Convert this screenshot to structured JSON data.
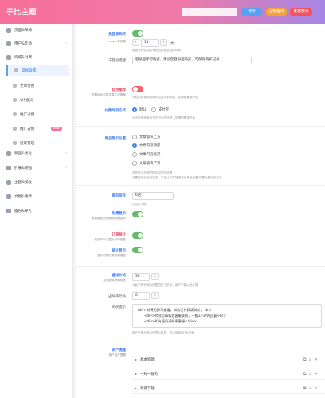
{
  "header": {
    "logo": "子比主题",
    "save_label": "保存",
    "export_label": "全部备份",
    "reset_label": "重置部分"
  },
  "sidebar": {
    "items": [
      {
        "label": "页面&布局",
        "icon": "layout-icon"
      },
      {
        "label": "用户&互动",
        "icon": "user-icon"
      },
      {
        "label": "商城&付费",
        "icon": "shop-icon"
      }
    ],
    "subitems": [
      {
        "label": "常规设置",
        "active": true
      },
      {
        "label": "文章付费"
      },
      {
        "label": "VIP会员"
      },
      {
        "label": "推广返佣"
      },
      {
        "label": "推广返佣",
        "badge": "NEW"
      },
      {
        "label": "提现管理"
      }
    ],
    "lower_items": [
      {
        "label": "新品&优化",
        "icon": "star-icon"
      },
      {
        "label": "扩展&增强",
        "icon": "plugin-icon"
      },
      {
        "label": "主题&模板",
        "icon": "theme-icon"
      },
      {
        "label": "文档&更新",
        "icon": "doc-icon"
      },
      {
        "label": "备份&导入",
        "icon": "backup-icon"
      }
    ]
  },
  "form": {
    "r1_label": "免登录购买",
    "r1_sub": "cookie有效期",
    "r1_value": "15",
    "r1_unit": "天",
    "r1_help": "免登录购买后的有效期为登录后的时间",
    "r2_label": "未登录提醒",
    "r2_value": "登录后即可购买，建议您登录后购买，可保存购买记录",
    "r3_label": "启用推荐",
    "r3_sub": "配置后台付费文章生成推荐",
    "r3_help": "开启后将使用推荐内容显示到页面，如需配置请开启",
    "r4_label": "付款时的方式",
    "r4_opt1": "默认",
    "r4_opt2": "支付宝",
    "r4_help": "为支付宝或其他方式显示的选项，如需配置请开启",
    "r5_label": "商品显示位置",
    "r5_opt1": "文章版块上方",
    "r5_opt2": "文章内容顶部",
    "r5_opt3": "文章内容底部",
    "r5_opt4": "文章版块下方",
    "r5_help1": "选定显示在哪里购买相关的设置",
    "r5_help2": "设置完成后已经生效，不会让文章被修改为其他位置,位置设置后已生效",
    "r6_label": "商品货号",
    "r6_value": "6月",
    "r6_hint": "(商品-订单)",
    "r7_label": "免费显示",
    "r7_sub": "免费商品处理商品价格显示",
    "r8_label": "订单统计",
    "r8_sub": "在用户中心显示订单信息",
    "r9_label": "统计显示",
    "r9_sub": "显示已购买数量和销量",
    "r10_label": "虚拟价格",
    "r10_sub": "显示虚拟价格标签",
    "r10_value": "30",
    "r10_help": "以此中的价格为依据进行了折扣，用户不能以此计算",
    "r11_label": "虚拟库存数",
    "r11_value": "0",
    "r12_label": "购买提示",
    "r12_line1": "<div>付费后即可查看，如若已付款请刷新，<br>",
    "r12_line2": "<div>付款后请私信客服获取，一般1小时内回复<br>",
    "r12_line3": "<div>如有疑问请联系客服</div>",
    "r12_help": "用户付费后显示的提示信息，可以使用HTML代码",
    "r13_label": "资产提醒",
    "r13_sub": "用户资产提醒",
    "acc1": "基本资源",
    "acc2": "一对一服务",
    "acc3": "资源下载"
  }
}
